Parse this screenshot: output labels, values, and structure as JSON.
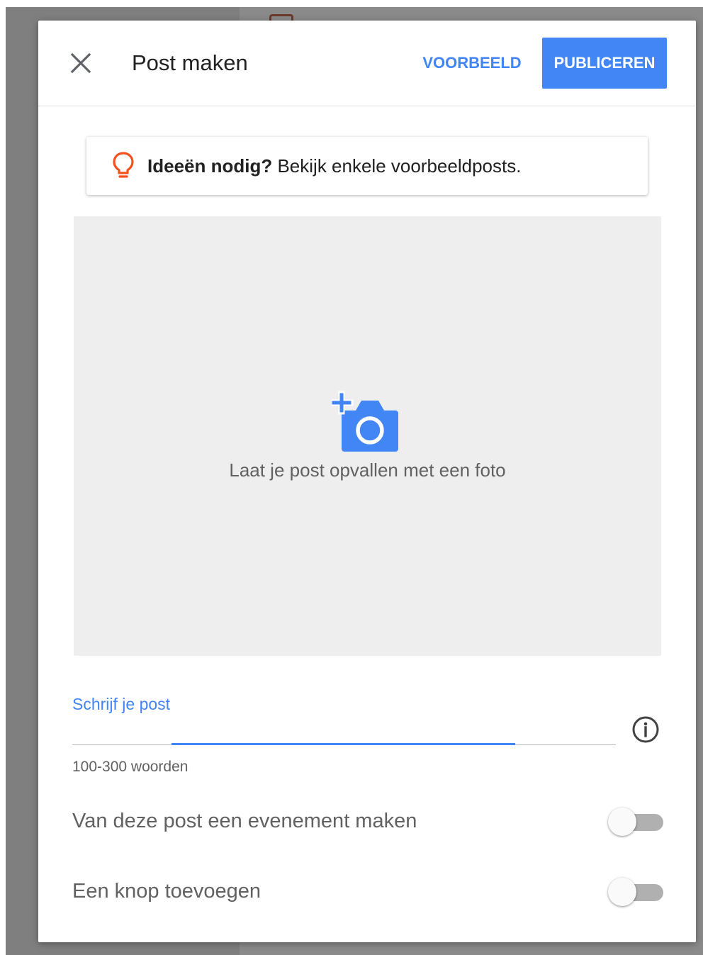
{
  "header": {
    "title": "Post maken",
    "preview_label": "VOORBEELD",
    "publish_label": "PUBLICEREN"
  },
  "ideas": {
    "bold": "Ideeën nodig?",
    "text": " Bekijk enkele voorbeeldposts."
  },
  "photo": {
    "label": "Laat je post opvallen met een foto"
  },
  "post": {
    "label": "Schrijf je post",
    "value": "",
    "helper": "100-300 woorden"
  },
  "toggles": [
    {
      "label": "Van deze post een evenement maken",
      "on": false
    },
    {
      "label": "Een knop toevoegen",
      "on": false
    }
  ],
  "colors": {
    "accent": "#4285f4",
    "bulb": "#f4511e",
    "photo_bg": "#eeeeee",
    "switch_track_off": "#b0b0b0"
  },
  "icons": {
    "close": "close-icon",
    "bulb": "lightbulb-icon",
    "camera": "add-photo-icon",
    "info": "info-icon"
  }
}
